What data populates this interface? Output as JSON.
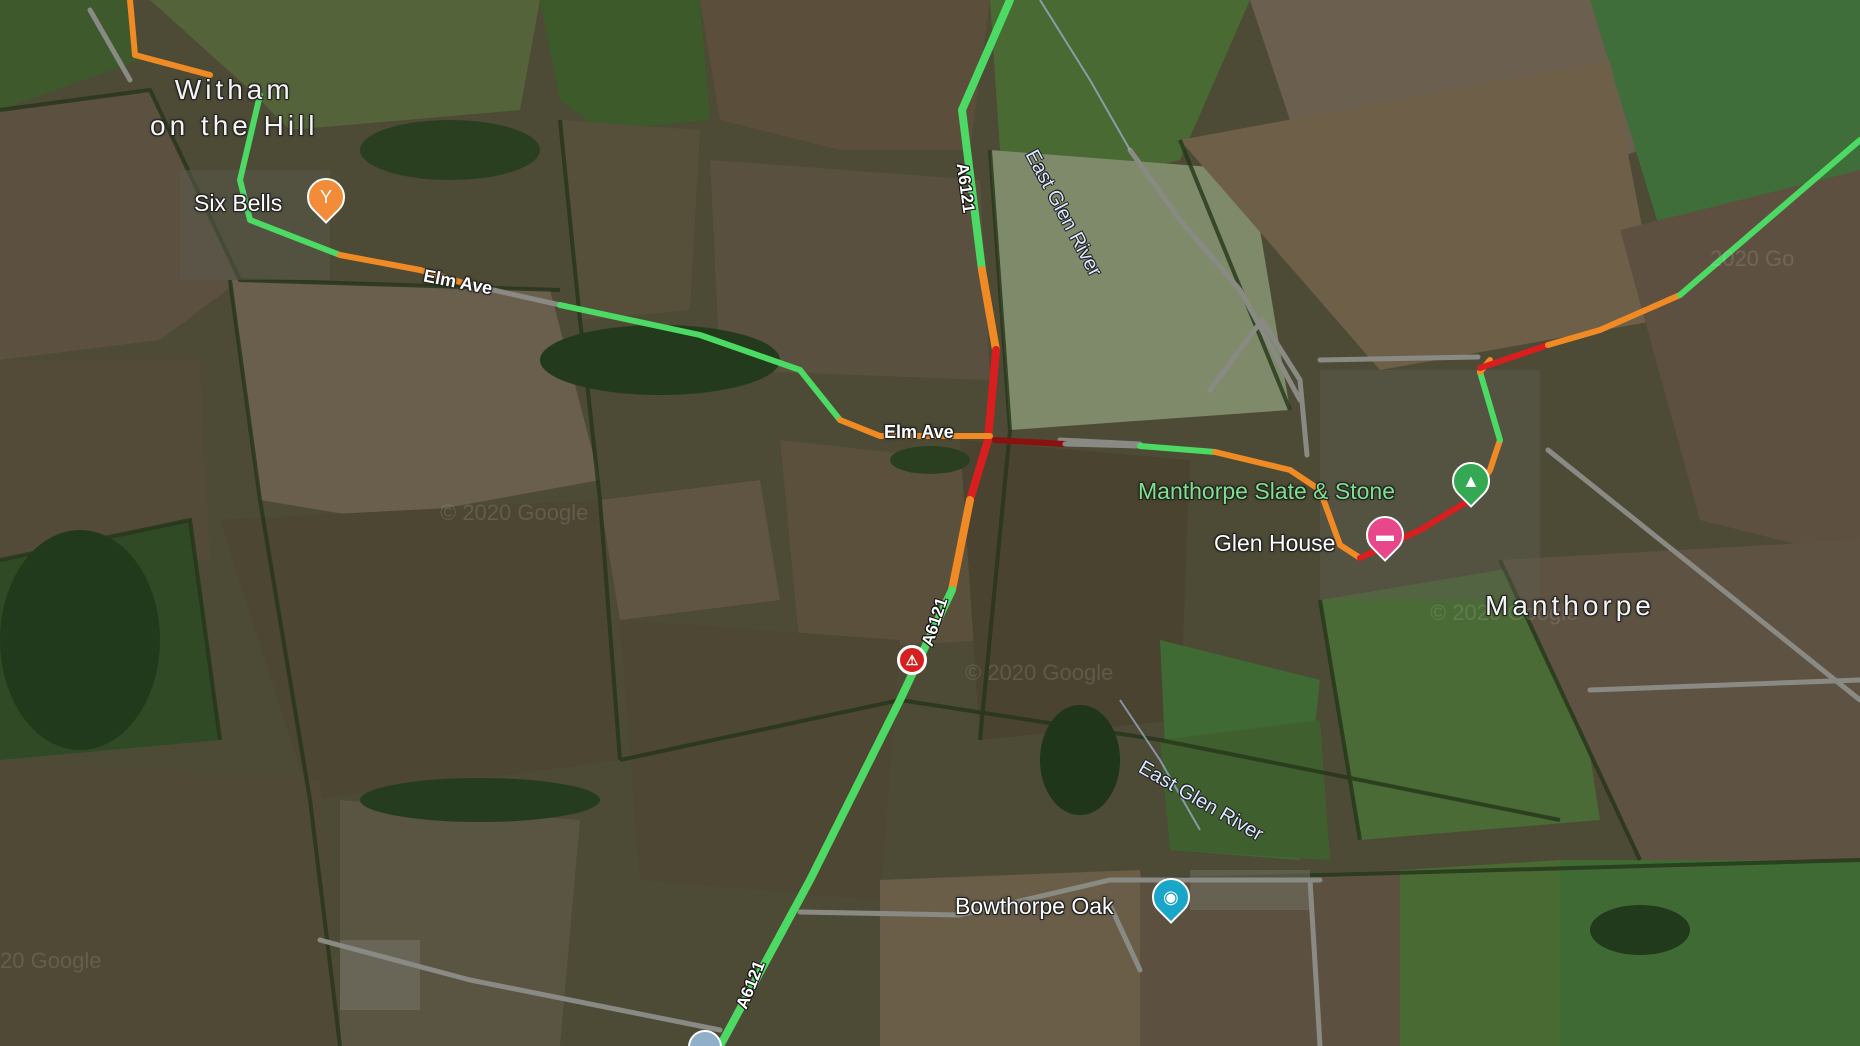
{
  "places": {
    "witham": "Witham\non the Hill",
    "manthorpe": "Manthorpe"
  },
  "pois": {
    "six_bells": "Six Bells",
    "manthorpe_slate": "Manthorpe Slate & Stone",
    "glen_house": "Glen House",
    "bowthorpe_oak": "Bowthorpe Oak"
  },
  "roads": {
    "elm_ave_1": "Elm Ave",
    "elm_ave_2": "Elm Ave",
    "a6121_top": "A6121",
    "a6121_mid": "A6121",
    "a6121_bottom": "A6121"
  },
  "rivers": {
    "east_glen_top": "East Glen River",
    "east_glen_bottom": "East Glen River"
  },
  "watermarks": {
    "w1": "© 2020 Google",
    "w2": "© 2020 Google",
    "w3": "2020 Go",
    "w4": "20 Google",
    "w5": "© 2020 Google"
  },
  "colors": {
    "traffic_green": "#4cd964",
    "traffic_orange": "#f08a24",
    "traffic_red": "#d81e1e",
    "traffic_dark_red": "#8b1010",
    "poi_orange": "#f28c38",
    "poi_green": "#34a853",
    "poi_pink": "#e8488a",
    "poi_teal": "#1aa6c8"
  },
  "icons": {
    "six_bells": "bar-icon",
    "manthorpe_slate": "park-icon",
    "glen_house": "hotel-icon",
    "bowthorpe_oak": "camera-icon",
    "incident": "traffic-incident-icon"
  }
}
